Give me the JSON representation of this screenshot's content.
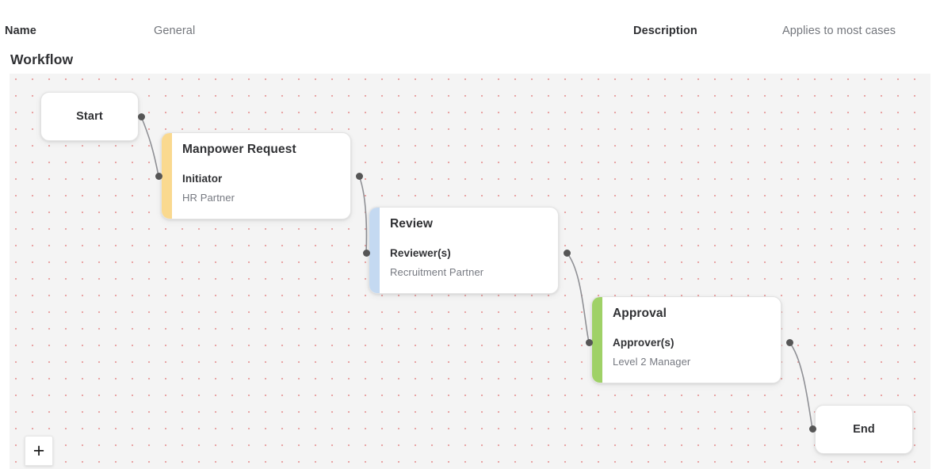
{
  "meta": {
    "name_label": "Name",
    "name_value": "General",
    "description_label": "Description",
    "description_value": "Applies to most cases"
  },
  "section": {
    "title": "Workflow"
  },
  "canvas": {
    "add_button_icon": "plus-icon",
    "add_button_label": "+",
    "grid_dot_color": "#de5a5a",
    "background_color": "#f4f4f4"
  },
  "workflow": {
    "nodes": [
      {
        "id": "start",
        "type": "terminal",
        "label": "Start"
      },
      {
        "id": "manpower-request",
        "type": "step",
        "title": "Manpower Request",
        "role_label": "Initiator",
        "assignee": "HR Partner",
        "accent_color": "#fad98f"
      },
      {
        "id": "review",
        "type": "step",
        "title": "Review",
        "role_label": "Reviewer(s)",
        "assignee": "Recruitment Partner",
        "accent_color": "#c4d9f1"
      },
      {
        "id": "approval",
        "type": "step",
        "title": "Approval",
        "role_label": "Approver(s)",
        "assignee": "Level 2 Manager",
        "accent_color": "#9fd167"
      },
      {
        "id": "end",
        "type": "terminal",
        "label": "End"
      }
    ],
    "edges": [
      {
        "from": "start",
        "to": "manpower-request"
      },
      {
        "from": "manpower-request",
        "to": "review"
      },
      {
        "from": "review",
        "to": "approval"
      },
      {
        "from": "approval",
        "to": "end"
      }
    ]
  }
}
